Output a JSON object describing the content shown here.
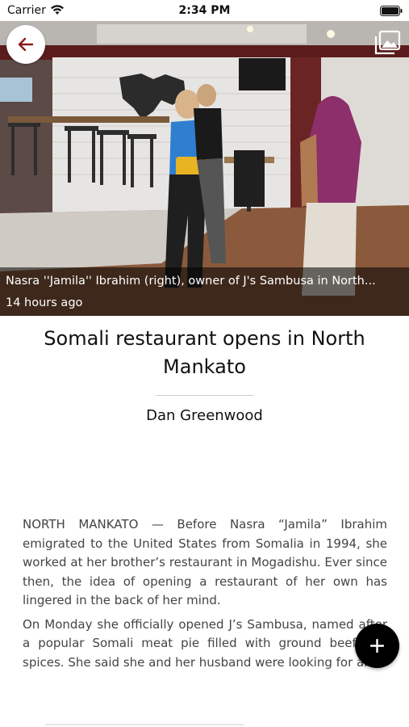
{
  "status_bar": {
    "carrier": "Carrier",
    "time": "2:34 PM"
  },
  "hero": {
    "caption": "Nasra ''Jamila'' Ibrahim (right), owner of J's Sambusa in North...",
    "timestamp": "14 hours ago",
    "back_icon": "back-arrow-icon",
    "gallery_icon": "image-gallery-icon"
  },
  "article": {
    "headline": "Somali restaurant opens in North Mankato",
    "byline": "Dan Greenwood",
    "paragraphs": [
      "NORTH MANKATO — Before Nasra “Jamila” Ibrahim emigrated to the United States from Somalia in 1994, she worked at her brother’s restaurant in Mogadishu. Ever since then, the idea of opening a restaurant of her own has lingered in the back of her mind.",
      "On Monday she officially opened J’s Sambusa, named after a popular Somali meat pie filled with ground beef and spices. She said she and her husband were looking for an"
    ]
  },
  "fab": {
    "icon": "plus-icon"
  },
  "colors": {
    "accent": "#8b1a1a",
    "caption_bg": "rgba(0,0,0,0.55)",
    "fab_bg": "#000000"
  }
}
